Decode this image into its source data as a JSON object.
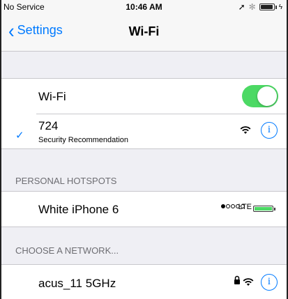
{
  "status_bar": {
    "carrier": "No Service",
    "time": "10:46 AM",
    "location_icon": "location-arrow-icon",
    "bluetooth_icon": "bluetooth-icon",
    "battery_icon": "battery-charging-icon"
  },
  "nav": {
    "back_label": "Settings",
    "title": "Wi-Fi"
  },
  "wifi_toggle": {
    "label": "Wi-Fi",
    "on": true,
    "color": "#4cd964"
  },
  "connected_network": {
    "name": "724",
    "subtitle": "Security Recommendation",
    "checked": true
  },
  "personal_hotspots": {
    "header": "PERSONAL HOTSPOTS",
    "items": [
      {
        "name": "White iPhone 6",
        "signal_dots": 1,
        "signal_total": 5,
        "network_type": "LTE",
        "battery_color": "#4cd964"
      }
    ]
  },
  "choose_network": {
    "header": "CHOOSE A NETWORK...",
    "items": [
      {
        "name": "acus_11 5GHz",
        "locked": true
      }
    ]
  },
  "accent_color": "#007aff"
}
